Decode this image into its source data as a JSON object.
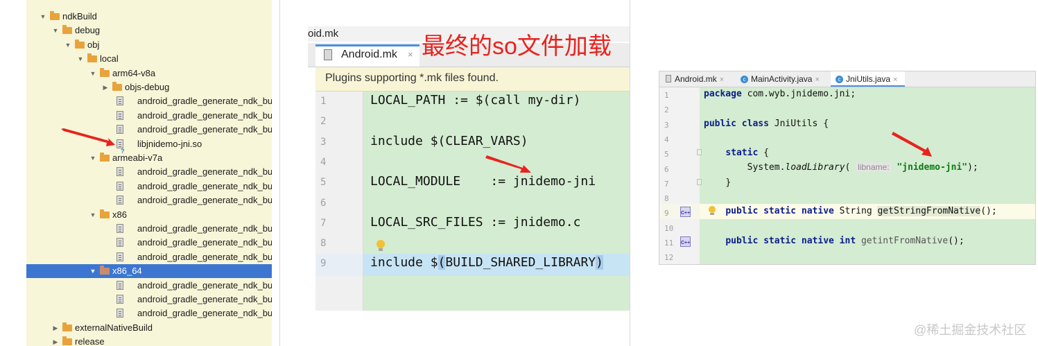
{
  "tree": {
    "rows": [
      {
        "label": "ndkBuild",
        "kind": "folder",
        "expanded": true
      },
      {
        "label": "debug",
        "kind": "folder",
        "expanded": true
      },
      {
        "label": "obj",
        "kind": "folder",
        "expanded": true
      },
      {
        "label": "local",
        "kind": "folder",
        "expanded": true
      },
      {
        "label": "arm64-v8a",
        "kind": "folder",
        "expanded": true
      },
      {
        "label": "objs-debug",
        "kind": "folder",
        "expanded": false
      },
      {
        "label": "android_gradle_generate_ndk_buil",
        "kind": "file"
      },
      {
        "label": "android_gradle_generate_ndk_buil",
        "kind": "file"
      },
      {
        "label": "android_gradle_generate_ndk_buil",
        "kind": "file"
      },
      {
        "label": "libjnidemo-jni.so",
        "kind": "so-file"
      },
      {
        "label": "armeabi-v7a",
        "kind": "folder",
        "expanded": true
      },
      {
        "label": "android_gradle_generate_ndk_buil",
        "kind": "file"
      },
      {
        "label": "android_gradle_generate_ndk_buil",
        "kind": "file"
      },
      {
        "label": "android_gradle_generate_ndk_buil",
        "kind": "file"
      },
      {
        "label": "x86",
        "kind": "folder",
        "expanded": true
      },
      {
        "label": "android_gradle_generate_ndk_buil",
        "kind": "file"
      },
      {
        "label": "android_gradle_generate_ndk_buil",
        "kind": "file"
      },
      {
        "label": "android_gradle_generate_ndk_buil",
        "kind": "file"
      },
      {
        "label": "x86_64",
        "kind": "folder",
        "expanded": true,
        "selected": true
      },
      {
        "label": "android_gradle_generate_ndk_buil",
        "kind": "file"
      },
      {
        "label": "android_gradle_generate_ndk_buil",
        "kind": "file"
      },
      {
        "label": "android_gradle_generate_ndk_buil",
        "kind": "file"
      },
      {
        "label": "externalNativeBuild",
        "kind": "folder",
        "expanded": false
      },
      {
        "label": "release",
        "kind": "folder",
        "expanded": false
      }
    ]
  },
  "middle": {
    "window_title": "oid.mk",
    "tab_label": "Android.mk",
    "tab_close": "×",
    "annotation": "最终的so文件加载",
    "banner": "Plugins supporting *.mk files found.",
    "lines": [
      {
        "n": "1",
        "code": "LOCAL_PATH := $(call my-dir)"
      },
      {
        "n": "2",
        "code": ""
      },
      {
        "n": "3",
        "code": "include $(CLEAR_VARS)"
      },
      {
        "n": "4",
        "code": ""
      },
      {
        "n": "5",
        "code": "LOCAL_MODULE    := jnidemo-jni"
      },
      {
        "n": "6",
        "code": ""
      },
      {
        "n": "7",
        "code": "LOCAL_SRC_FILES := jnidemo.c"
      },
      {
        "n": "8",
        "code": ""
      },
      {
        "n": "9",
        "code_parts": [
          "include $",
          "(",
          "BUILD_SHARED_LIBRARY",
          ")"
        ]
      }
    ]
  },
  "right": {
    "tabs": [
      {
        "label": "Android.mk",
        "icon": "file-icon"
      },
      {
        "label": "MainActivity.java",
        "icon": "class-icon"
      },
      {
        "label": "JniUtils.java",
        "icon": "class-icon",
        "active": true
      }
    ],
    "tab_close": "×",
    "class_icon_letter": "c",
    "cpp_badge": "C++",
    "line_numbers": [
      "1",
      "2",
      "3",
      "4",
      "5",
      "6",
      "7",
      "8",
      "9",
      "10",
      "11",
      "12"
    ],
    "code": {
      "l1_kw": "package",
      "l1_rest": " com.wyb.jnidemo.jni;",
      "l3_kw": "public class",
      "l3_rest": " JniUtils {",
      "l5_kw": "static",
      "l5_rest": " {",
      "l6_pre": "System.",
      "l6_method": "loadLibrary",
      "l6_open": "( ",
      "l6_hint": "libname:",
      "l6_str": "\"jnidemo-jni\"",
      "l6_close": ");",
      "l7": "}",
      "l9_kw": "public static native",
      "l9_type": " String ",
      "l9_name": "getStringFromNative",
      "l9_end": "();",
      "l11_kw": "public static native int",
      "l11_name": " getintFromNative",
      "l11_end": "();"
    }
  },
  "watermark": "@稀土掘金技术社区",
  "colors": {
    "arrow": "#e8231f",
    "code_bg": "#d4ecd1",
    "tree_bg": "#f8f6d8",
    "selection": "#3d76d1",
    "keyword": "#0a1e8c",
    "string": "#0d7a15"
  }
}
